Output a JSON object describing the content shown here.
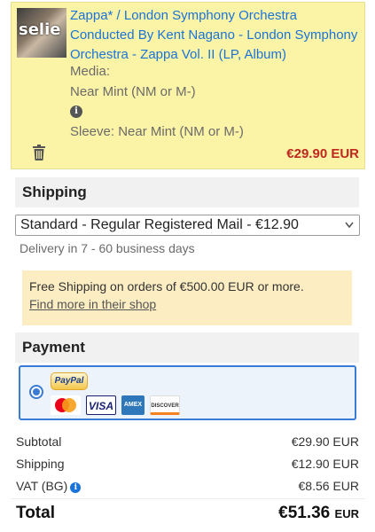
{
  "item": {
    "title": "Zappa* / London Symphony Orchestra Conducted By Kent Nagano - London Symphony Orchestra - Zappa Vol. II (LP, Album)",
    "thumbnail_watermark": "selie",
    "media_label": "Media:",
    "media_condition": "Near Mint (NM or M-)",
    "sleeve_condition": "Sleeve: Near Mint (NM or M-)",
    "price": "€29.90 EUR",
    "info_icon": "info-icon",
    "delete_icon": "trash-icon"
  },
  "shipping": {
    "heading": "Shipping",
    "selected_method": "Standard - Regular Registered Mail - €12.90",
    "delivery": "Delivery in 7 - 60 business days",
    "free_shipping_notice": "Free Shipping on orders of €500.00 EUR or more.",
    "shop_link": "Find more in their shop"
  },
  "payment": {
    "heading": "Payment",
    "paypal_label": "PayPal",
    "cards": [
      "MasterCard",
      "VISA",
      "AMEX",
      "DISCOVER"
    ]
  },
  "summary": {
    "subtotal_label": "Subtotal",
    "subtotal_value": "€29.90 EUR",
    "shipping_label": "Shipping",
    "shipping_value": "€12.90 EUR",
    "vat_label": "VAT (BG)",
    "vat_value": "€8.56 EUR",
    "total_label": "Total",
    "total_value": "€51.36",
    "total_unit": "EUR"
  },
  "colors": {
    "item_background": "#fbf3a6",
    "link_blue": "#1a73d9",
    "price_red": "#c0271e",
    "notice_background": "#fcedc2",
    "selected_border": "#3a7bd5"
  }
}
